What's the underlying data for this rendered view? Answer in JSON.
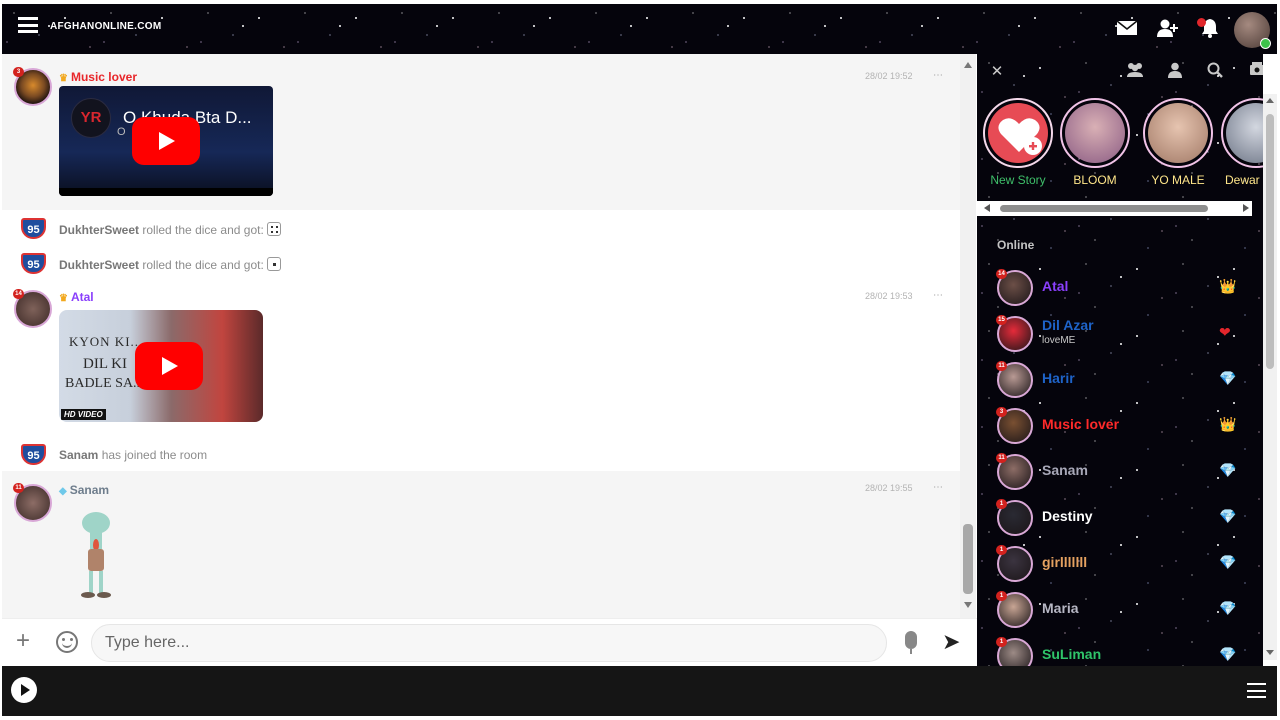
{
  "app": {
    "brand": "AFGHANONLINE.COM"
  },
  "topbar": {
    "mail_icon": "✉",
    "add_friend_icon": "👤+",
    "bell_icon": "🔔"
  },
  "messages": [
    {
      "user": "Music lover",
      "rank": "3",
      "role_icon": "crown",
      "time": "28/02 19:52",
      "video_title": "O Khuda Bta D...",
      "video_channel_logo": "YR",
      "video_sub": "O"
    },
    {
      "type": "system",
      "user": "DukhterSweet",
      "text": " rolled the dice and got:",
      "dice": 4
    },
    {
      "type": "system",
      "user": "DukhterSweet",
      "text": " rolled the dice and got:",
      "dice": 1
    },
    {
      "user": "Atal",
      "rank": "14",
      "role_icon": "crown",
      "time": "28/02 19:53",
      "video_line1": "KYON KI...",
      "video_line2": "DIL KI",
      "video_line3": "BADLE SA...",
      "video_badge": "HD VIDEO"
    },
    {
      "type": "system",
      "user": "Sanam",
      "text": " has joined the room"
    },
    {
      "user": "Sanam",
      "rank": "11",
      "role_icon": "diamond",
      "time": "28/02 19:55"
    }
  ],
  "system_avatar_text": "95",
  "more_label": "⋯",
  "composer": {
    "placeholder": "Type here...",
    "plus": "+",
    "send_icon": "➤"
  },
  "sidebar": {
    "online_header": "Online",
    "stories": [
      {
        "label": "New Story",
        "color": "#ff8fb0"
      },
      {
        "label": "BLOOM",
        "color": "#b36fa5"
      },
      {
        "label": "YO MALE",
        "color": "#c89a86"
      },
      {
        "label": "Dewar",
        "color": "#9aa2b5"
      }
    ],
    "users": [
      {
        "name": "Atal",
        "rank": "14",
        "color": "#8a3ffc",
        "badge": "👑",
        "badge_color": "#f2b51f",
        "avatar": "#6c4f47"
      },
      {
        "name": "Dil Azar",
        "mood": "loveME",
        "rank": "15",
        "color": "#1e63c8",
        "badge": "❤",
        "badge_color": "#e3262c",
        "avatar": "#e52b3a"
      },
      {
        "name": "Harir",
        "rank": "11",
        "color": "#1e63c8",
        "badge": "💎",
        "badge_color": "#7fd8f3",
        "avatar": "#b99a94"
      },
      {
        "name": "Music lover",
        "rank": "3",
        "color": "#ff2a2a",
        "badge": "👑",
        "badge_color": "#f2b51f",
        "avatar": "#7a5032"
      },
      {
        "name": "Sanam",
        "rank": "11",
        "color": "#a8a8b8",
        "badge": "💎",
        "badge_color": "#7fd8f3",
        "avatar": "#8d6d66"
      },
      {
        "name": "Destiny",
        "rank": "1",
        "color": "#ffffff",
        "badge": "💎",
        "badge_color": "#e58de8",
        "avatar": "#2a2a33"
      },
      {
        "name": "girlllllll",
        "rank": "1",
        "color": "#e5a160",
        "badge": "💎",
        "badge_color": "#e58de8",
        "avatar": "#3b3440"
      },
      {
        "name": "Maria",
        "rank": "1",
        "color": "#b7b7c4",
        "badge": "💎",
        "badge_color": "#e58de8",
        "avatar": "#c8a594"
      },
      {
        "name": "SuLiman",
        "rank": "1",
        "color": "#2fc46a",
        "badge": "💎",
        "badge_color": "#e58de8",
        "avatar": "#9d8b86"
      }
    ]
  }
}
